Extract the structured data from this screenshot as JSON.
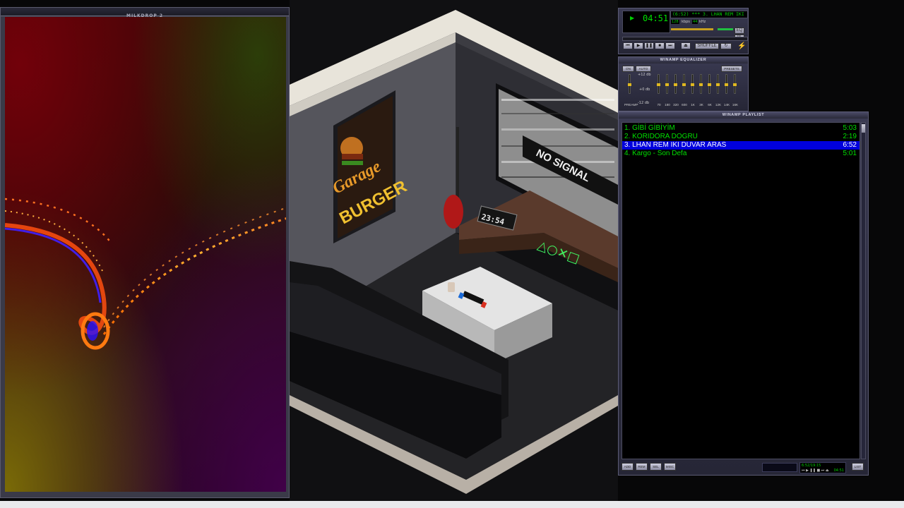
{
  "milkdrop": {
    "title": "MILKDROP 2"
  },
  "wallpaper": {
    "poster_line1": "Garage",
    "poster_line2": "BURGER",
    "clock": "23:54",
    "tv_text": "NO SIGNAL",
    "neon_sign": "△○✕□"
  },
  "winamp": {
    "time": "04:51",
    "marquee": "(6:52) *** 3. LHAN REM IKI D",
    "kbps_value": "128",
    "kbps_label": "kbps",
    "khz_value": "44",
    "khz_label": "kHz",
    "shuffle_label": "SHUFFLE",
    "eq_button": "EQ",
    "pl_button": "PL"
  },
  "equalizer": {
    "title": "WINAMP EQUALIZER",
    "on_label": "ON",
    "auto_label": "AUTO",
    "presets_label": "PRESETS",
    "db_top": "+12 db",
    "db_mid": "+0 db",
    "db_bot": "-12 db",
    "preamp_label": "PREAMP",
    "bands": [
      "70",
      "180",
      "320",
      "600",
      "1K",
      "3K",
      "6K",
      "12K",
      "14K",
      "16K"
    ]
  },
  "playlist": {
    "title": "WINAMP PLAYLIST",
    "tracks": [
      {
        "label": "1. GİBİ GİBİYİM",
        "duration": "5:03"
      },
      {
        "label": "2. KORIDORA DOGRU",
        "duration": "2:19"
      },
      {
        "label": "3. LHAN  REM   IKI DUVAR ARAS",
        "duration": "6:52"
      },
      {
        "label": "4. Kargo - Son Defa",
        "duration": "5:01"
      }
    ],
    "btn_add": "ADD",
    "btn_rem": "REM",
    "btn_sel": "SEL",
    "btn_misc": "MISC",
    "btn_list": "LIST",
    "time_info": "6:52/19:15",
    "mini_time": "04:51"
  },
  "colors": {
    "lcd_green": "#00e000",
    "selection_blue": "#0000dd",
    "frame": "#2e2e42"
  }
}
